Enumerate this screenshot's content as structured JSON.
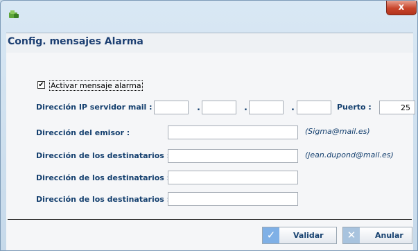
{
  "window": {
    "close_glyph": "x",
    "close_color": "#c7452b"
  },
  "header": {
    "title": "Config. mensajes Alarma"
  },
  "form": {
    "activar": {
      "label": "Activar mensaje alarma",
      "checked": true,
      "check_glyph": "✔"
    },
    "ip": {
      "label": "Dirección IP servidor mail :",
      "octets": [
        "",
        "",
        "",
        ""
      ],
      "separator": "."
    },
    "puerto": {
      "label": "Puerto :",
      "value": "25"
    },
    "emisor": {
      "label": "Dirección del emisor :",
      "value": "",
      "hint": "(Sigma@mail.es)"
    },
    "destinatarios": [
      {
        "label": "Dirección de los destinatarios :",
        "value": "",
        "hint": "(jean.dupond@mail.es)"
      },
      {
        "label": "Dirección de los destinatarios :",
        "value": "",
        "hint": ""
      },
      {
        "label": "Dirección de los destinatarios :",
        "value": ""
      }
    ]
  },
  "buttons": {
    "validar": {
      "label": "Validar",
      "icon": "check-icon",
      "glyph": "✓",
      "color": "#7fb0e6"
    },
    "anular": {
      "label": "Anular",
      "icon": "close-icon",
      "glyph": "✕",
      "color": "#a8c3de"
    }
  }
}
